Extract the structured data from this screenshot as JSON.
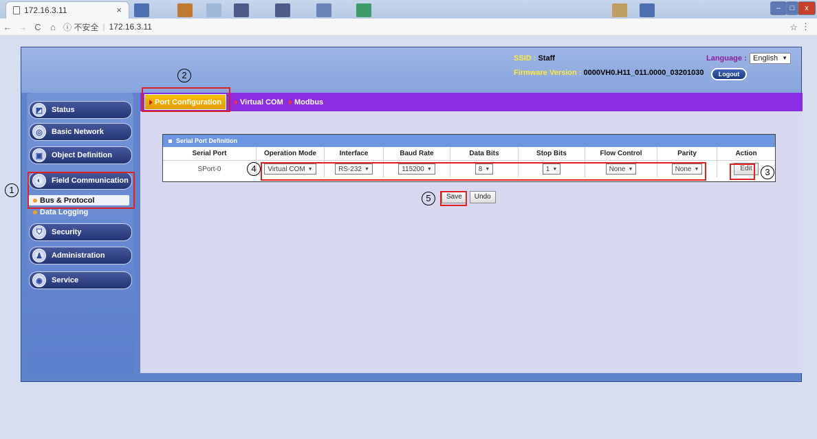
{
  "browser": {
    "tab_title": "172.16.3.11",
    "tab_close": "×",
    "security_label": "ⓘ 不安全",
    "url": "172.16.3.11",
    "window_buttons": [
      "–",
      "□",
      "x"
    ]
  },
  "header": {
    "ssid_label": "SSID :",
    "ssid_value": "Staff",
    "firmware_label": "Firmware Version :",
    "firmware_value": "0000VH0.H11_011.0000_03201030",
    "language_label": "Language :",
    "language_value": "English",
    "logout_label": "Logout"
  },
  "sidebar": {
    "items": [
      {
        "label": "Status",
        "icon": "status-icon"
      },
      {
        "label": "Basic Network",
        "icon": "network-icon"
      },
      {
        "label": "Object Definition",
        "icon": "object-icon"
      },
      {
        "label": "Field Communication",
        "icon": "field-icon"
      },
      {
        "label": "Security",
        "icon": "shield-icon"
      },
      {
        "label": "Administration",
        "icon": "admin-icon"
      },
      {
        "label": "Service",
        "icon": "service-icon"
      }
    ],
    "subitems": [
      {
        "label": "Bus & Protocol",
        "active": true
      },
      {
        "label": "Data Logging",
        "active": false
      }
    ]
  },
  "tabs": [
    {
      "label": "Port Configuration",
      "active": true
    },
    {
      "label": "Virtual COM",
      "active": false
    },
    {
      "label": "Modbus",
      "active": false
    }
  ],
  "section": {
    "title": "Serial Port Definition",
    "columns": [
      "Serial Port",
      "Operation Mode",
      "Interface",
      "Baud Rate",
      "Data Bits",
      "Stop Bits",
      "Flow Control",
      "Parity",
      "Action"
    ],
    "row": {
      "serial_port": "SPort-0",
      "operation_mode": "Virtual COM",
      "interface": "RS-232",
      "baud_rate": "115200",
      "data_bits": "8",
      "stop_bits": "1",
      "flow_control": "None",
      "parity": "None",
      "action": "Edit"
    }
  },
  "buttons": {
    "save": "Save",
    "undo": "Undo"
  },
  "annotations": [
    "1",
    "2",
    "3",
    "4",
    "5"
  ],
  "colors": {
    "accent_purple": "#8b2de0",
    "tab_active": "#f8c000",
    "annotation_red": "#e02020",
    "sidebar_blue": "#233474"
  }
}
